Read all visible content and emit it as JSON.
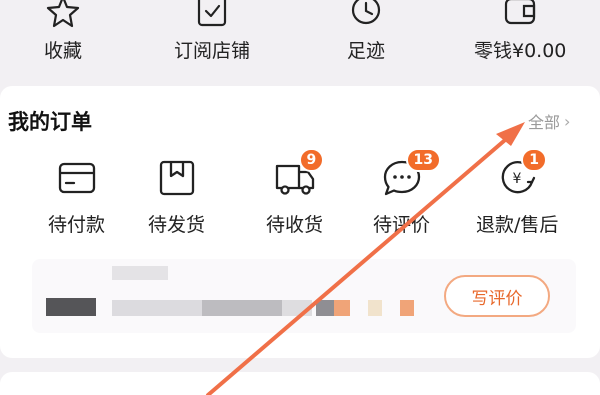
{
  "top_shortcuts": [
    {
      "label": "收藏",
      "icon": "star-icon"
    },
    {
      "label": "订阅店铺",
      "icon": "check-box-icon"
    },
    {
      "label": "足迹",
      "icon": "clock-icon"
    },
    {
      "label": "零钱¥0.00",
      "icon": "wallet-icon"
    }
  ],
  "orders": {
    "title": "我的订单",
    "all_label": "全部",
    "items": [
      {
        "label": "待付款",
        "icon": "card-icon",
        "badge": ""
      },
      {
        "label": "待发货",
        "icon": "package-icon",
        "badge": ""
      },
      {
        "label": "待收货",
        "icon": "truck-icon",
        "badge": "9"
      },
      {
        "label": "待评价",
        "icon": "chat-bubble-icon",
        "badge": "13"
      },
      {
        "label": "退款/售后",
        "icon": "refund-icon",
        "badge": "1"
      }
    ]
  },
  "recent_order": {
    "review_button": "写评价"
  },
  "colors": {
    "accent": "#f26c2a",
    "annotation_arrow": "#f07048",
    "background": "#f2f0f3"
  }
}
